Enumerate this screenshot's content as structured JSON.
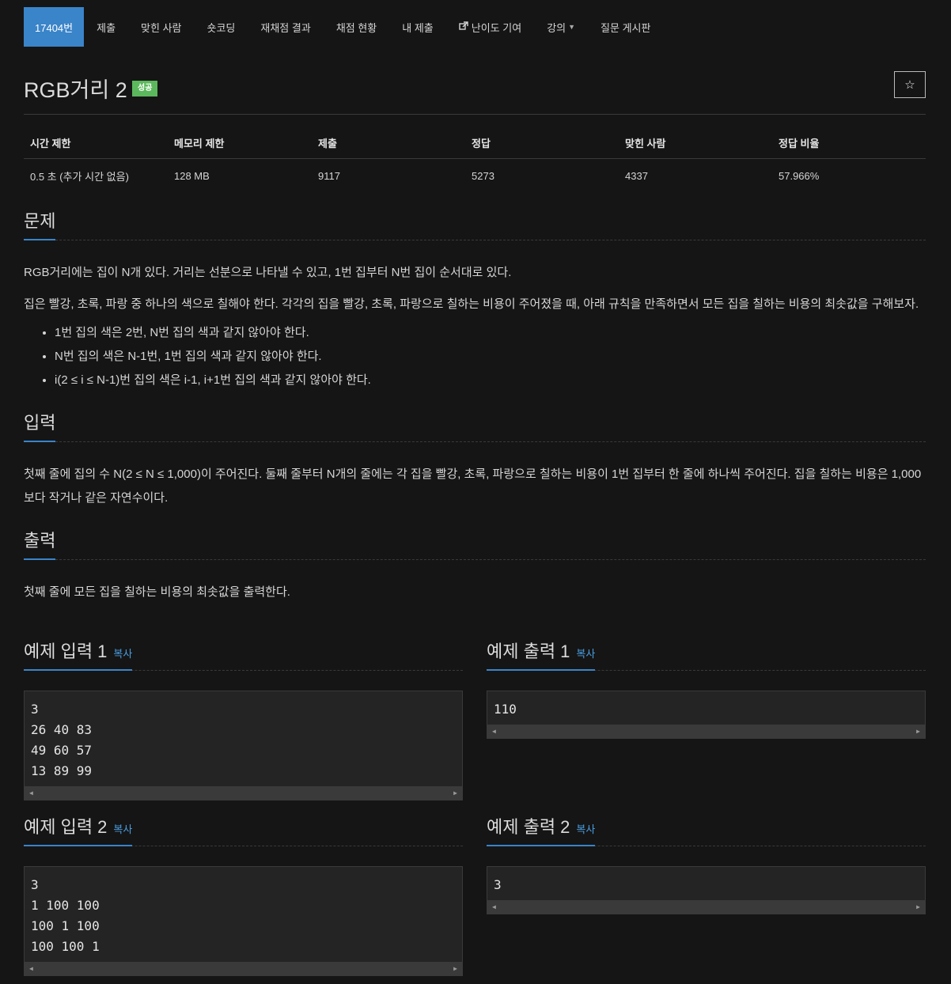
{
  "nav": {
    "items": [
      {
        "label": "17404번"
      },
      {
        "label": "제출"
      },
      {
        "label": "맞힌 사람"
      },
      {
        "label": "숏코딩"
      },
      {
        "label": "재채점 결과"
      },
      {
        "label": "채점 현황"
      },
      {
        "label": "내 제출"
      },
      {
        "label": "난이도 기여"
      },
      {
        "label": "강의"
      },
      {
        "label": "질문 게시판"
      }
    ]
  },
  "problem": {
    "title": "RGB거리 2",
    "badge": "성공",
    "star": "☆"
  },
  "info": {
    "headers": [
      "시간 제한",
      "메모리 제한",
      "제출",
      "정답",
      "맞힌 사람",
      "정답 비율"
    ],
    "values": [
      "0.5 초 (추가 시간 없음)",
      "128 MB",
      "9117",
      "5273",
      "4337",
      "57.966%"
    ]
  },
  "sections": {
    "problem": {
      "title": "문제",
      "p1": "RGB거리에는 집이 N개 있다. 거리는 선분으로 나타낼 수 있고, 1번 집부터 N번 집이 순서대로 있다.",
      "p2": "집은 빨강, 초록, 파랑 중 하나의 색으로 칠해야 한다. 각각의 집을 빨강, 초록, 파랑으로 칠하는 비용이 주어졌을 때, 아래 규칙을 만족하면서 모든 집을 칠하는 비용의 최솟값을 구해보자.",
      "rules": [
        "1번 집의 색은 2번, N번 집의 색과 같지 않아야 한다.",
        "N번 집의 색은 N-1번, 1번 집의 색과 같지 않아야 한다.",
        "i(2 ≤ i ≤ N-1)번 집의 색은 i-1, i+1번 집의 색과 같지 않아야 한다."
      ]
    },
    "input": {
      "title": "입력",
      "p1": "첫째 줄에 집의 수 N(2 ≤ N ≤ 1,000)이 주어진다. 둘째 줄부터 N개의 줄에는 각 집을 빨강, 초록, 파랑으로 칠하는 비용이 1번 집부터 한 줄에 하나씩 주어진다. 집을 칠하는 비용은 1,000보다 작거나 같은 자연수이다."
    },
    "output": {
      "title": "출력",
      "p1": "첫째 줄에 모든 집을 칠하는 비용의 최솟값을 출력한다."
    }
  },
  "examples": {
    "copy_label": "복사",
    "in1": {
      "title": "예제 입력 1",
      "lines": [
        "3",
        "26 40 83",
        "49 60 57",
        "13 89 99"
      ]
    },
    "out1": {
      "title": "예제 출력 1",
      "lines": [
        "110"
      ]
    },
    "in2": {
      "title": "예제 입력 2",
      "lines": [
        "3",
        "1 100 100",
        "100 1 100",
        "100 100 1"
      ]
    },
    "out2": {
      "title": "예제 출력 2",
      "lines": [
        "3"
      ]
    }
  }
}
